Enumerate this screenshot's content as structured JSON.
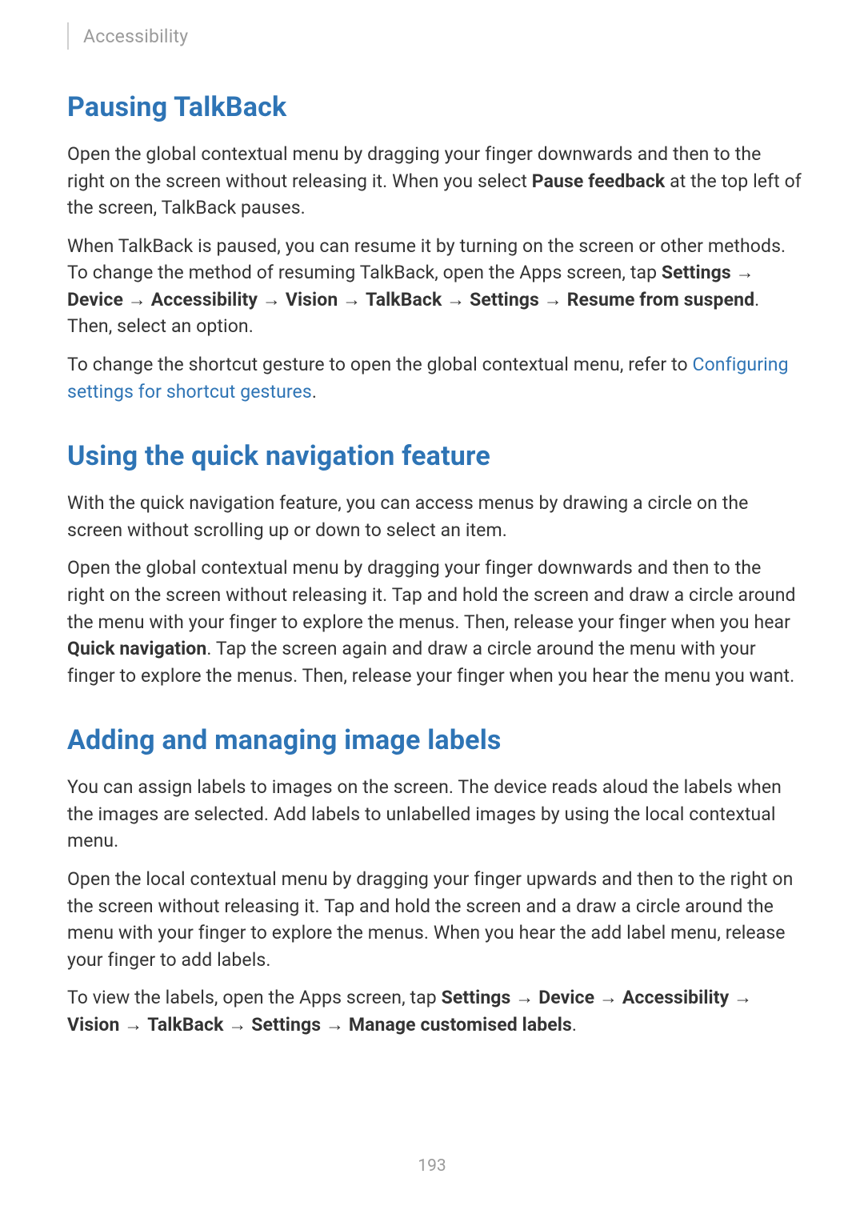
{
  "breadcrumb": "Accessibility",
  "page_number": "193",
  "sections": {
    "pausing": {
      "heading": "Pausing TalkBack",
      "p1_pre": "Open the global contextual menu by dragging your finger downwards and then to the right on the screen without releasing it. When you select ",
      "p1_bold": "Pause feedback",
      "p1_post": " at the top left of the screen, TalkBack pauses.",
      "p2_pre": "When TalkBack is paused, you can resume it by turning on the screen or other methods. To change the method of resuming TalkBack, open the Apps screen, tap ",
      "p2_settings": "Settings",
      "p2_arr1": " → ",
      "p2_device": "Device",
      "p2_arr2": " → ",
      "p2_access": "Accessibility",
      "p2_arr3": " → ",
      "p2_vision": "Vision",
      "p2_arr4": " → ",
      "p2_talkback": "TalkBack",
      "p2_arr5": " → ",
      "p2_settings2": "Settings",
      "p2_arr6": " → ",
      "p2_resume": "Resume from suspend",
      "p2_post": ". Then, select an option.",
      "p3_pre": "To change the shortcut gesture to open the global contextual menu, refer to ",
      "p3_link": "Configuring settings for shortcut gestures",
      "p3_post": "."
    },
    "quicknav": {
      "heading": "Using the quick navigation feature",
      "p1": "With the quick navigation feature, you can access menus by drawing a circle on the screen without scrolling up or down to select an item.",
      "p2_pre": "Open the global contextual menu by dragging your finger downwards and then to the right on the screen without releasing it. Tap and hold the screen and draw a circle around the menu with your finger to explore the menus. Then, release your finger when you hear ",
      "p2_bold": "Quick navigation",
      "p2_post": ". Tap the screen again and draw a circle around the menu with your finger to explore the menus. Then, release your finger when you hear the menu you want."
    },
    "labels": {
      "heading": "Adding and managing image labels",
      "p1": "You can assign labels to images on the screen. The device reads aloud the labels when the images are selected. Add labels to unlabelled images by using the local contextual menu.",
      "p2": "Open the local contextual menu by dragging your finger upwards and then to the right on the screen without releasing it. Tap and hold the screen and a draw a circle around the menu with your finger to explore the menus. When you hear the add label menu, release your finger to add labels.",
      "p3_pre": "To view the labels, open the Apps screen, tap ",
      "p3_settings": "Settings",
      "p3_arr1": " → ",
      "p3_device": "Device",
      "p3_arr2": " → ",
      "p3_access": "Accessibility",
      "p3_arr3": " → ",
      "p3_vision": "Vision",
      "p3_arr4": " → ",
      "p3_talkback": "TalkBack",
      "p3_arr5": " → ",
      "p3_settings2": "Settings",
      "p3_arr6": " → ",
      "p3_manage": "Manage customised labels",
      "p3_post": "."
    }
  }
}
